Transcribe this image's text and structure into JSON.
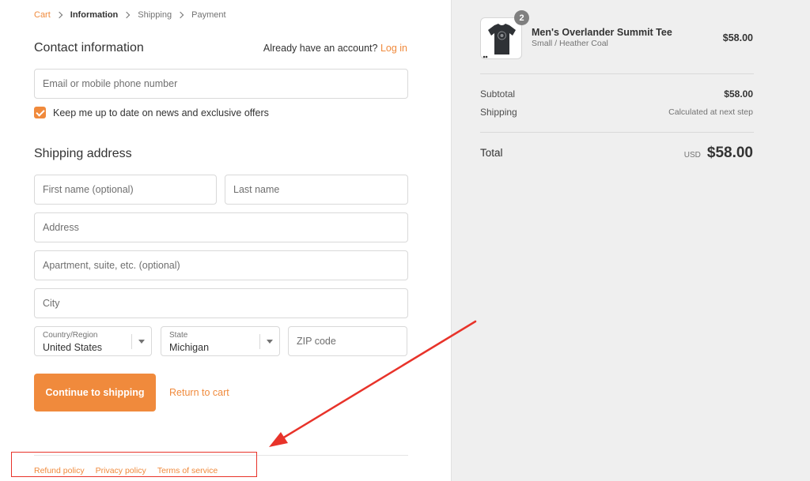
{
  "breadcrumb": {
    "cart": "Cart",
    "information": "Information",
    "shipping": "Shipping",
    "payment": "Payment"
  },
  "contact": {
    "title": "Contact information",
    "account_prompt": "Already have an account?",
    "login_label": "Log in",
    "email_placeholder": "Email or mobile phone number",
    "newsletter_label": "Keep me up to date on news and exclusive offers",
    "newsletter_checked": true
  },
  "shipping": {
    "title": "Shipping address",
    "first_name_placeholder": "First name (optional)",
    "last_name_placeholder": "Last name",
    "address_placeholder": "Address",
    "apartment_placeholder": "Apartment, suite, etc. (optional)",
    "city_placeholder": "City",
    "country_label": "Country/Region",
    "country_value": "United States",
    "state_label": "State",
    "state_value": "Michigan",
    "zip_placeholder": "ZIP code"
  },
  "actions": {
    "continue_label": "Continue to shipping",
    "return_label": "Return to cart"
  },
  "footer": {
    "refund": "Refund policy",
    "privacy": "Privacy policy",
    "terms": "Terms of service"
  },
  "summary": {
    "item": {
      "quantity": "2",
      "title": "Men's Overlander Summit Tee",
      "variant": "Small / Heather Coal",
      "price": "$58.00"
    },
    "subtotal_label": "Subtotal",
    "subtotal_value": "$58.00",
    "shipping_label": "Shipping",
    "shipping_value": "Calculated at next step",
    "total_label": "Total",
    "total_currency": "USD",
    "total_value": "$58.00"
  },
  "colors": {
    "accent": "#f08a3c",
    "annotation": "#e8332a",
    "sidebar_bg": "#efefef"
  },
  "icons": [
    "chevron-right-icon",
    "checkmark-icon",
    "caret-down-icon",
    "tshirt-icon"
  ]
}
